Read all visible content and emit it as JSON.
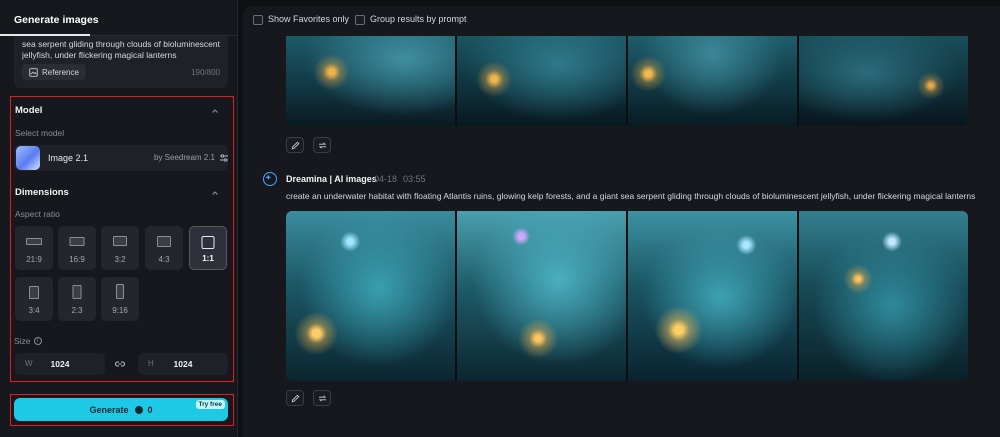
{
  "left_panel": {
    "tab_title": "Generate images",
    "prompt_text": "sea serpent gliding through clouds of bioluminescent jellyfish, under flickering magical lanterns",
    "reference_label": "Reference",
    "char_count": "190/800",
    "model_section": {
      "title": "Model",
      "select_label": "Select model",
      "model_name": "Image 2.1",
      "model_by": "by Seedream 2.1"
    },
    "dimensions_section": {
      "title": "Dimensions",
      "aspect_label": "Aspect ratio",
      "ratios": [
        "21:9",
        "16:9",
        "3:2",
        "4:3",
        "1:1",
        "3:4",
        "2:3",
        "9:16"
      ],
      "selected_ratio": "1:1",
      "size_label": "Size",
      "width_prefix": "W",
      "width_value": "1024",
      "height_prefix": "H",
      "height_value": "1024"
    },
    "generate": {
      "label": "Generate",
      "cost": "0",
      "badge": "Try free"
    }
  },
  "main": {
    "filters": {
      "favorites_label": "Show Favorites only",
      "group_label": "Group results by prompt"
    },
    "result": {
      "author": "Dreamina | AI images",
      "date": "04-18",
      "time": "03:55",
      "prompt": "create an underwater habitat with floating Atlantis ruins, glowing kelp forests, and a giant sea serpent gliding through clouds of bioluminescent jellyfish, under flickering magical lanterns"
    }
  },
  "colors": {
    "accent": "#1ec9e6",
    "highlight_box": "#e02020",
    "panel_bg": "#16181d"
  }
}
